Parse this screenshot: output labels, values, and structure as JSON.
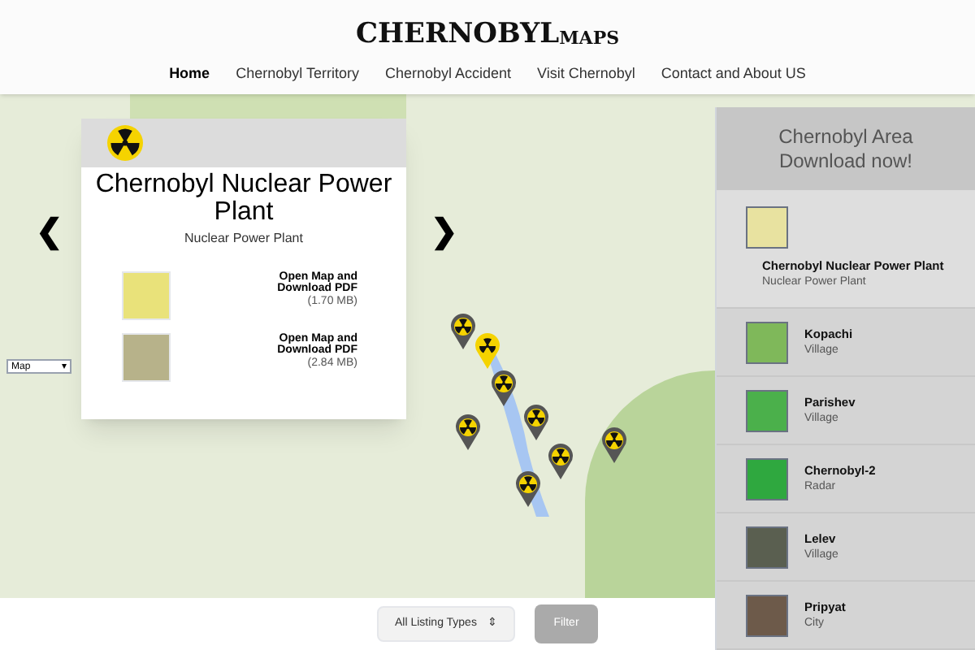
{
  "header": {
    "logo": {
      "main": "CHERNOBYL",
      "suffix": "MAPS"
    },
    "nav": [
      {
        "label": "Home",
        "selected": true
      },
      {
        "label": "Chernobyl Territory",
        "selected": false
      },
      {
        "label": "Chernobyl Accident",
        "selected": false
      },
      {
        "label": "Visit Chernobyl",
        "selected": false
      },
      {
        "label": "Contact and About US",
        "selected": false
      }
    ]
  },
  "map": {
    "map_type": "Map",
    "map_type_arrow": "▾",
    "markers": [
      {
        "selected": false
      },
      {
        "selected": true
      },
      {
        "selected": false
      },
      {
        "selected": false
      },
      {
        "selected": false
      },
      {
        "selected": false
      },
      {
        "selected": false
      },
      {
        "selected": false
      }
    ]
  },
  "popup": {
    "title": "Chernobyl Nuclear Power Plant",
    "subtitle": "Nuclear Power Plant",
    "prev": "❮",
    "next": "❯",
    "downloads": [
      {
        "label": "Open Map and Download PDF",
        "size": "(1.70 MB)"
      },
      {
        "label": "Open Map and Download PDF",
        "size": "(2.84 MB)"
      }
    ]
  },
  "sidebar": {
    "heading": [
      "Chernobyl Area",
      "Download now!"
    ],
    "items": [
      {
        "title": "Chernobyl Nuclear Power Plant",
        "type": "Nuclear Power Plant",
        "selected": true
      },
      {
        "title": "Kopachi",
        "type": "Village",
        "selected": false
      },
      {
        "title": "Parishev",
        "type": "Village",
        "selected": false
      },
      {
        "title": "Chernobyl-2",
        "type": "Radar",
        "selected": false
      },
      {
        "title": "Lelev",
        "type": "Village",
        "selected": false
      },
      {
        "title": "Pripyat",
        "type": "City",
        "selected": false
      }
    ]
  },
  "filter_bar": {
    "listing_type": "All Listing Types",
    "select_arrow": "⇕",
    "filter_button": "Filter"
  }
}
